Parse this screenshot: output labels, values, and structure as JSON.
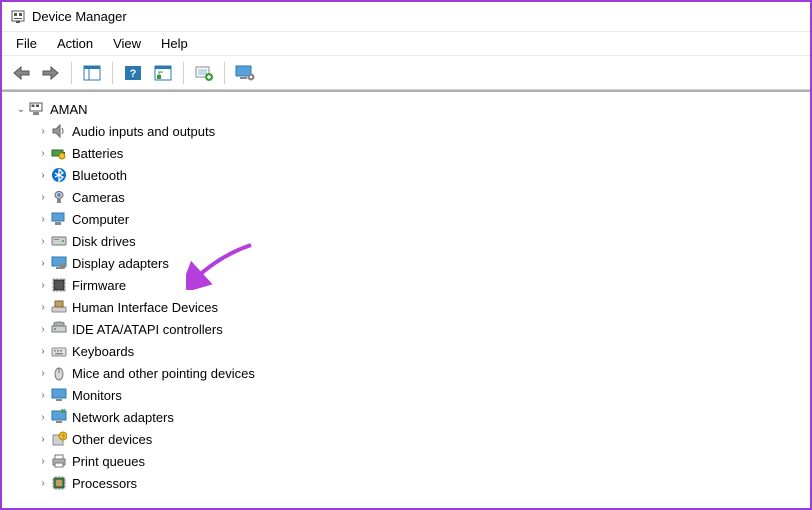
{
  "window": {
    "title": "Device Manager"
  },
  "menubar": {
    "items": [
      "File",
      "Action",
      "View",
      "Help"
    ]
  },
  "toolbar": {
    "buttons": [
      {
        "name": "back-button",
        "icon": "arrow-left"
      },
      {
        "name": "forward-button",
        "icon": "arrow-right"
      },
      {
        "name": "show-hide-tree-button",
        "icon": "console-tree"
      },
      {
        "name": "help-button",
        "icon": "help-square"
      },
      {
        "name": "action-button",
        "icon": "action-pane"
      },
      {
        "name": "scan-hardware-button",
        "icon": "scan-hardware"
      },
      {
        "name": "devices-button",
        "icon": "monitor-gear"
      }
    ],
    "separators_after": [
      1,
      2,
      4,
      5
    ]
  },
  "tree": {
    "root": {
      "label": "AMAN",
      "expanded": true,
      "icon": "computer"
    },
    "categories": [
      {
        "label": "Audio inputs and outputs",
        "icon": "speaker"
      },
      {
        "label": "Batteries",
        "icon": "battery"
      },
      {
        "label": "Bluetooth",
        "icon": "bluetooth"
      },
      {
        "label": "Cameras",
        "icon": "camera"
      },
      {
        "label": "Computer",
        "icon": "computer"
      },
      {
        "label": "Disk drives",
        "icon": "disk"
      },
      {
        "label": "Display adapters",
        "icon": "display"
      },
      {
        "label": "Firmware",
        "icon": "firmware"
      },
      {
        "label": "Human Interface Devices",
        "icon": "hid"
      },
      {
        "label": "IDE ATA/ATAPI controllers",
        "icon": "ide"
      },
      {
        "label": "Keyboards",
        "icon": "keyboard"
      },
      {
        "label": "Mice and other pointing devices",
        "icon": "mouse"
      },
      {
        "label": "Monitors",
        "icon": "monitor"
      },
      {
        "label": "Network adapters",
        "icon": "network"
      },
      {
        "label": "Other devices",
        "icon": "other"
      },
      {
        "label": "Print queues",
        "icon": "printer"
      },
      {
        "label": "Processors",
        "icon": "cpu"
      }
    ]
  },
  "annotation": {
    "arrow_color": "#b53fdd",
    "target_index": 6
  }
}
